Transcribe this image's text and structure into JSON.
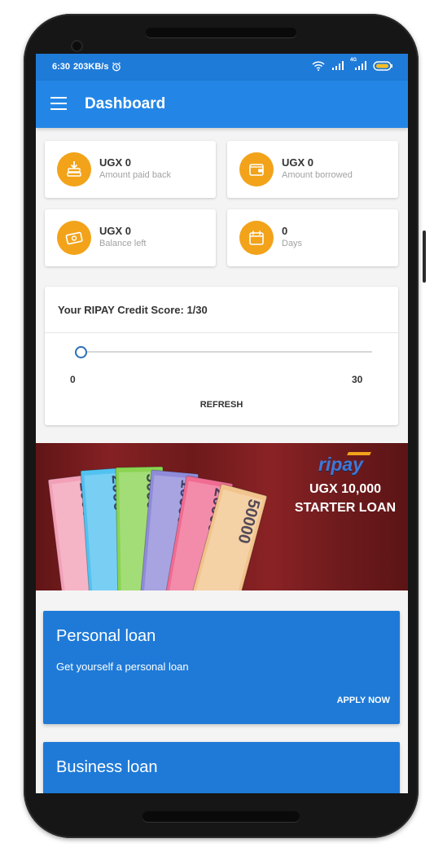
{
  "status_bar": {
    "time": "6:30",
    "speed": "203KB/s",
    "icons": [
      "alarm-icon",
      "wifi-icon",
      "signal-icon",
      "battery-icon"
    ],
    "signal_label": "4G"
  },
  "app_bar": {
    "title": "Dashboard",
    "menu_icon": "hamburger-menu-icon"
  },
  "stats": [
    {
      "value": "UGX 0",
      "label": "Amount paid back",
      "icon": "money-return-icon"
    },
    {
      "value": "UGX 0",
      "label": "Amount borrowed",
      "icon": "wallet-icon"
    },
    {
      "value": "UGX 0",
      "label": "Balance left",
      "icon": "cash-icon"
    },
    {
      "value": "0",
      "label": "Days",
      "icon": "calendar-icon"
    }
  ],
  "credit_score": {
    "title": "Your RIPAY Credit Score: 1/30",
    "score": 1,
    "min_label": "0",
    "max_label": "30",
    "refresh_label": "REFRESH"
  },
  "banner": {
    "brand": "ripay",
    "line1": "UGX 10,000",
    "line2": "STARTER LOAN",
    "notes": [
      "1000",
      "2000",
      "5000",
      "10000",
      "20000",
      "50000"
    ],
    "note_colors": [
      "#f2a0b7",
      "#52c2f0",
      "#8ad451",
      "#8f8bd9",
      "#f06c93",
      "#f2c48d"
    ]
  },
  "loans": [
    {
      "title": "Personal loan",
      "subtitle": "Get yourself a personal loan",
      "action": "APPLY NOW"
    },
    {
      "title": "Business loan",
      "subtitle": "",
      "action": ""
    }
  ],
  "colors": {
    "primary": "#2386e6",
    "status_bar": "#1f7bd8",
    "accent": "#f2a31a",
    "loan_card": "#1f7ad7"
  }
}
